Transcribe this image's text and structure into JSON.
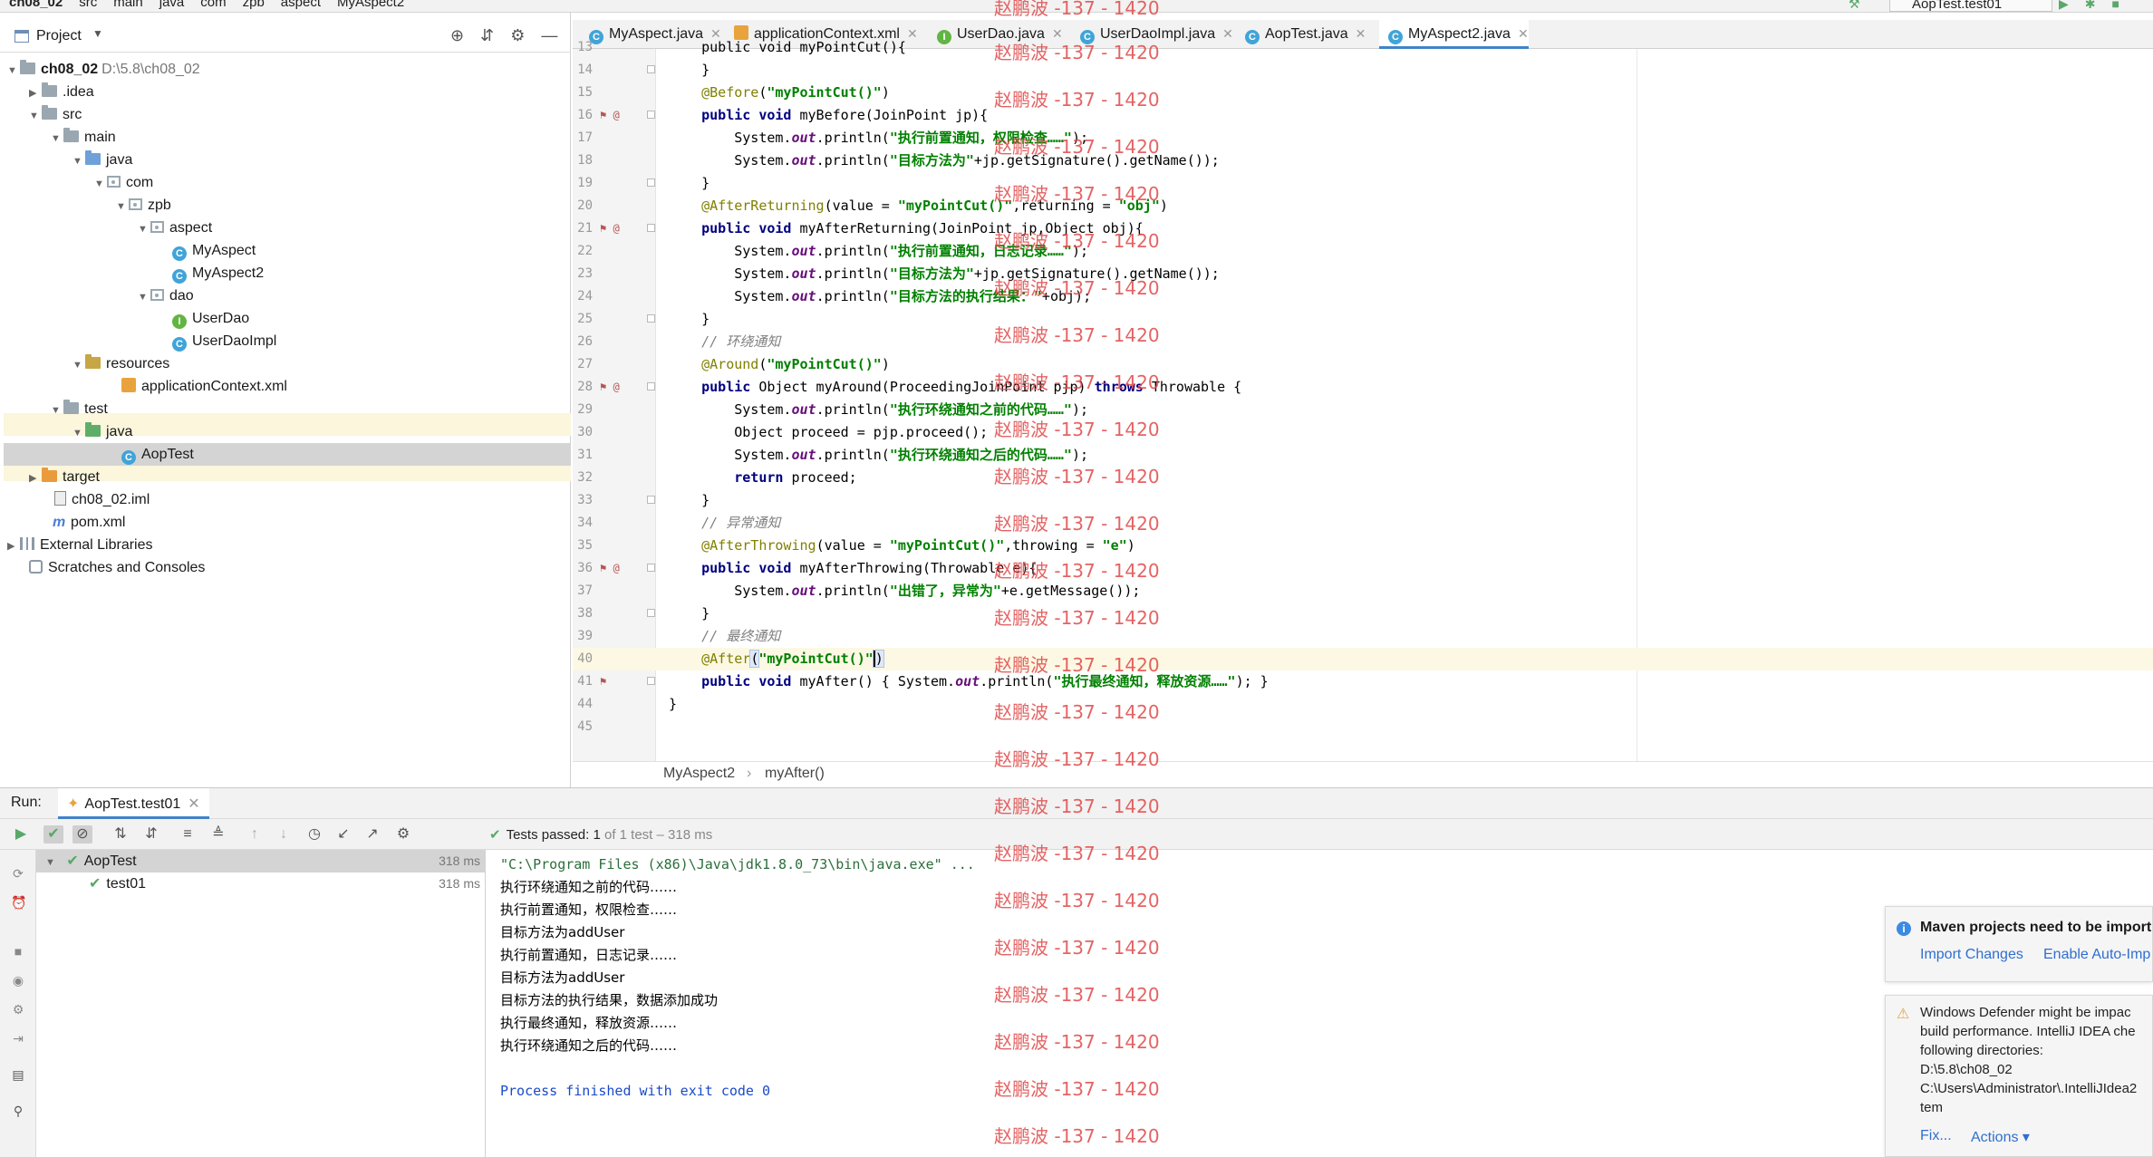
{
  "navbar": {
    "crumbs": [
      "ch08_02",
      "src",
      "main",
      "java",
      "com",
      "zpb",
      "aspect",
      "MyAspect2"
    ],
    "run_config": "AopTest.test01"
  },
  "project": {
    "title": "Project",
    "tree": [
      {
        "label": "ch08_02",
        "extra": "D:\\5.8\\ch08_02"
      },
      {
        "label": ".idea"
      },
      {
        "label": "src"
      },
      {
        "label": "main"
      },
      {
        "label": "java"
      },
      {
        "label": "com"
      },
      {
        "label": "zpb"
      },
      {
        "label": "aspect"
      },
      {
        "label": "MyAspect"
      },
      {
        "label": "MyAspect2"
      },
      {
        "label": "dao"
      },
      {
        "label": "UserDao"
      },
      {
        "label": "UserDaoImpl"
      },
      {
        "label": "resources"
      },
      {
        "label": "applicationContext.xml"
      },
      {
        "label": "test"
      },
      {
        "label": "java"
      },
      {
        "label": "AopTest"
      },
      {
        "label": "target"
      },
      {
        "label": "ch08_02.iml"
      },
      {
        "label": "pom.xml"
      },
      {
        "label": "External Libraries"
      },
      {
        "label": "Scratches and Consoles"
      }
    ]
  },
  "tabs": [
    "MyAspect.java",
    "applicationContext.xml",
    "UserDao.java",
    "UserDaoImpl.java",
    "AopTest.java",
    "MyAspect2.java"
  ],
  "editor": {
    "line_numbers": [
      "13",
      "14",
      "15",
      "16",
      "17",
      "18",
      "19",
      "20",
      "21",
      "22",
      "23",
      "24",
      "25",
      "26",
      "27",
      "28",
      "29",
      "30",
      "31",
      "32",
      "33",
      "34",
      "35",
      "36",
      "37",
      "38",
      "39",
      "40",
      "41",
      "44",
      "45"
    ],
    "lines": {
      "l13": "public void myPointCut(){",
      "l15_an": "@Before",
      "l15_st": "\"myPointCut()\"",
      "l16_a": "public void",
      "l16_b": " myBefore(JoinPoint jp){",
      "l17_a": "System.",
      "l17_out": "out",
      "l17_b": ".println(",
      "l17_st": "\"执行前置通知，权限检查……\"",
      "l18_st": "\"目标方法为\"",
      "l18_b": "+jp.getSignature().getName());",
      "l20_an": "@AfterReturning",
      "l20_a": "(value = ",
      "l20_st1": "\"myPointCut()\"",
      "l20_b": ",returning = ",
      "l20_st2": "\"obj\"",
      "l21_b": " myAfterReturning(JoinPoint jp,Object obj){",
      "l22_st": "\"执行前置通知，日志记录……\"",
      "l24_st": "\"目标方法的执行结果：\"",
      "l24_b": "+obj);",
      "l26_cm": "// 环绕通知",
      "l27_an": "@Around",
      "l28_a": "public",
      "l28_b": " Object myAround(ProceedingJoinPoint pjp) ",
      "l28_kw": "throws",
      "l28_c": " Throwable {",
      "l29_st": "\"执行环绕通知之前的代码……\"",
      "l30": "Object proceed = pjp.proceed();",
      "l31_st": "\"执行环绕通知之后的代码……\"",
      "l32_kw": "return",
      "l32_b": " proceed;",
      "l34_cm": "// 异常通知",
      "l35_an": "@AfterThrowing",
      "l35_b": ",throwing = ",
      "l35_st2": "\"e\"",
      "l36_b": " myAfterThrowing(Throwable e){",
      "l37_st": "\"出错了，异常为\"",
      "l37_b": "+e.getMessage());",
      "l39_cm": "// 最终通知",
      "l40_an": "@After",
      "l41_b": " myAfter() { System.",
      "l41_st": "\"执行最终通知，释放资源……\"",
      "l41_c": "); }"
    }
  },
  "edit_breadcrumb": [
    "MyAspect2",
    "myAfter()"
  ],
  "run": {
    "label": "Run:",
    "tab": "AopTest.test01",
    "status_prefix": "Tests passed:",
    "status_count": "1",
    "status_rest": "of 1 test – 318 ms",
    "tree": [
      {
        "label": "AopTest",
        "time": "318 ms"
      },
      {
        "label": "test01",
        "time": "318 ms"
      }
    ],
    "console": [
      "\"C:\\Program Files (x86)\\Java\\jdk1.8.0_73\\bin\\java.exe\" ...",
      "执行环绕通知之前的代码……",
      "执行前置通知，权限检查……",
      "目标方法为addUser",
      "执行前置通知，日志记录……",
      "目标方法为addUser",
      "目标方法的执行结果，数据添加成功",
      "执行最终通知，释放资源……",
      "执行环绕通知之后的代码……",
      "Process finished with exit code 0"
    ]
  },
  "watermark": "赵鹏波 -137 - 1420",
  "notifications": {
    "maven": {
      "title": "Maven projects need to be import",
      "link1": "Import Changes",
      "link2": "Enable Auto-Imp"
    },
    "defender": {
      "lines": [
        "Windows Defender might be impac",
        "build performance. IntelliJ IDEA che",
        "following directories:",
        "D:\\5.8\\ch08_02",
        "C:\\Users\\Administrator\\.IntelliJIdea2",
        "tem"
      ],
      "fix": "Fix...",
      "actions": "Actions ▾"
    }
  },
  "icons": [
    "project-icon",
    "locate-icon",
    "collapse-icon",
    "gear-icon",
    "hide-icon",
    "run-icon",
    "debug-icon",
    "hammer-icon",
    "info-icon",
    "warning-icon"
  ],
  "colors": {
    "accent": "#4083c9",
    "ok": "#59a869",
    "watermark": "#e04848"
  }
}
